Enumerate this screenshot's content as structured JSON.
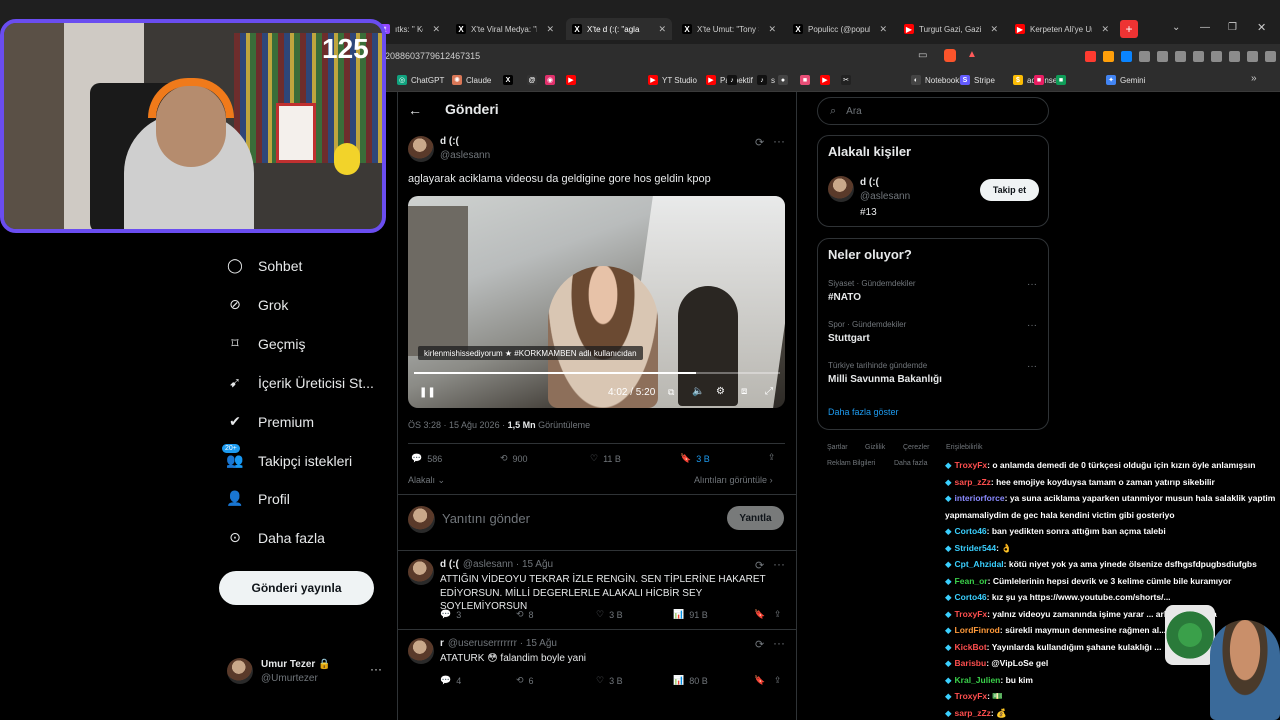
{
  "browser": {
    "tabs": [
      {
        "label": "ıtks: \" Konsol O",
        "icon": "twitch-icon",
        "color": "#9146ff"
      },
      {
        "label": "X'te Viral Medya: \"Big",
        "icon": "x-icon",
        "color": "#000000"
      },
      {
        "label": "X'te d (:(: \"agla",
        "icon": "x-icon",
        "color": "#000000",
        "active": true
      },
      {
        "label": "X'te Umut: \"Tony Stan",
        "icon": "x-icon",
        "color": "#000000"
      },
      {
        "label": "Populicc (@populicc)",
        "icon": "x-icon",
        "color": "#000000"
      },
      {
        "label": "Turgut Gazi, Gazi alp",
        "icon": "youtube-icon",
        "color": "#ff0000"
      },
      {
        "label": "Kerpeten Ali'ye Unutu",
        "icon": "youtube-icon",
        "color": "#ff0000"
      }
    ],
    "url": "2088603779612467315",
    "bookmarks": [
      {
        "label": "ChatGPT",
        "icon": "chatgpt-icon",
        "color": "#10a37f"
      },
      {
        "label": "Claude",
        "icon": "claude-icon",
        "color": "#d97757"
      },
      {
        "label": "",
        "icon": "x-icon",
        "color": "#000000"
      },
      {
        "label": "",
        "icon": "threads-icon",
        "color": "#333333"
      },
      {
        "label": "",
        "icon": "instagram-icon",
        "color": "#e1306c"
      },
      {
        "label": "",
        "icon": "youtube-icon",
        "color": "#ff0000"
      },
      {
        "label": "YT Studio",
        "icon": "youtube-studio-icon",
        "color": "#ff0000"
      },
      {
        "label": "Paspektif",
        "icon": "youtube-icon",
        "color": "#ff0000"
      },
      {
        "label": "",
        "icon": "tiktok-icon",
        "color": "#111111"
      },
      {
        "label": "s",
        "icon": "tiktok-icon",
        "color": "#111111"
      },
      {
        "label": "",
        "icon": "circle-icon",
        "color": "#444444"
      },
      {
        "label": "",
        "icon": "app-icon",
        "color": "#e94e77"
      },
      {
        "label": "",
        "icon": "youtube-icon",
        "color": "#ff0000"
      },
      {
        "label": "",
        "icon": "capcut-icon",
        "color": "#222222"
      },
      {
        "label": "NotebookLM",
        "icon": "notebooklm-icon",
        "color": "#444444"
      },
      {
        "label": "Stripe",
        "icon": "stripe-icon",
        "color": "#635bff"
      },
      {
        "label": "adsense",
        "icon": "adsense-icon",
        "color": "#fbbc04"
      },
      {
        "label": "",
        "icon": "app-icon",
        "color": "#e91e63"
      },
      {
        "label": "",
        "icon": "app-icon",
        "color": "#0f9d58"
      },
      {
        "label": "Gemini",
        "icon": "gemini-icon",
        "color": "#4285f4"
      }
    ]
  },
  "stream": {
    "counter": "125"
  },
  "sidebar": {
    "items": [
      {
        "label": "Sohbet",
        "icon": "chat-icon"
      },
      {
        "label": "Grok",
        "icon": "grok-icon"
      },
      {
        "label": "Geçmiş",
        "icon": "bookmark-icon"
      },
      {
        "label": "İçerik Üreticisi St...",
        "icon": "rocket-icon"
      },
      {
        "label": "Premium",
        "icon": "premium-icon"
      },
      {
        "label": "Takipçi istekleri",
        "icon": "followers-icon",
        "badge": "20+"
      },
      {
        "label": "Profil",
        "icon": "profile-icon"
      },
      {
        "label": "Daha fazla",
        "icon": "more-circle-icon"
      }
    ],
    "post_button": "Gönderi yayınla",
    "account": {
      "name": "Umur Tezer",
      "handle": "@Umurtezer"
    }
  },
  "main": {
    "header_title": "Gönderi",
    "post": {
      "author": "d (:(",
      "handle": "@aslesann",
      "text": "aglayarak aciklama videosu da geldigine gore hos geldin kpop",
      "video": {
        "caption": "kirlenmishissediyorum ★ #KORKMAMBEN adlı kullanıcıdan",
        "time": "4:02 / 5:20",
        "progress": 0.77
      },
      "meta_time": "ÖS 3:28 · 15 Ağu 2026 · ",
      "views": "1,5 Mn",
      "views_label": " Görüntüleme",
      "stats": {
        "replies": "586",
        "reposts": "900",
        "likes": "11 B",
        "bookmarks": "3 B"
      },
      "relevance": "Alakalı",
      "quotes_link": "Alıntıları görüntüle"
    },
    "reply_placeholder": "Yanıtını gönder",
    "reply_button": "Yanıtla",
    "replies": [
      {
        "author": "d (:(",
        "handle": "@aslesann · 15 Ağu",
        "text": "ATTIĞIN VİDEOYU TEKRAR İZLE RENGİN. SEN TİPLERİNE HAKARET EDİYORSUN. MİLLİ DEGERLERLE ALAKALI HİCBİR SEY SOYLEMİYORSUN",
        "stats": {
          "replies": "3",
          "reposts": "8",
          "likes": "3 B",
          "views": "91 B"
        }
      },
      {
        "author": "r",
        "handle": "@useruserrrrrrr · 15 Ağu",
        "text": "ATATURK 😳 falandim boyle yani",
        "stats": {
          "replies": "4",
          "reposts": "6",
          "likes": "3 B",
          "views": "80 B"
        }
      }
    ]
  },
  "right": {
    "search_placeholder": "Ara",
    "relevant_title": "Alakalı kişiler",
    "relevant_person": {
      "name": "d (:(",
      "handle": "@aslesann",
      "bio": "#13",
      "follow": "Takip et"
    },
    "trends_title": "Neler oluyor?",
    "trends": [
      {
        "category": "Siyaset · Gündemdekiler",
        "name": "#NATO"
      },
      {
        "category": "Spor · Gündemdekiler",
        "name": "Stuttgart"
      },
      {
        "category": "Türkiye tarihinde gündemde",
        "name": "Milli Savunma Bakanlığı"
      }
    ],
    "show_more": "Daha fazla göster",
    "footer": [
      "Şartlar",
      "Gizlilik",
      "Çerezler",
      "Erişilebilirlik",
      "Reklam Bilgileri",
      "Daha fazla"
    ]
  },
  "chat": {
    "messages": [
      {
        "user": "TroxyFx",
        "color": "#ff4f4f",
        "text": ": o anlamda demedi de 0 türkçesi olduğu için kızın öyle anlamışsın"
      },
      {
        "user": "sarp_zZz",
        "color": "#ff4f4f",
        "text": ": hee emojiye koyduysa tamam o zaman yatırıp sikebilir"
      },
      {
        "user": "interiorforce",
        "color": "#8a8aff",
        "text": ": ya suna aciklama yaparken utanmiyor musun hala salaklik yaptim"
      },
      {
        "user": "",
        "color": "#ffffff",
        "text": "yapmamaliydim de gec hala kendini victim gibi gosteriyo"
      },
      {
        "user": "Corto46",
        "color": "#3ad0ff",
        "text": ": ban yedikten sonra attığım ban açma talebi"
      },
      {
        "user": "Strider544",
        "color": "#3ad0ff",
        "text": ": 👌"
      },
      {
        "user": "Cpt_Ahzidal",
        "color": "#3ad0ff",
        "text": ": kötü niyet yok ya ama yinede ölsenize dsfhgsfdpugbsdiufgbs"
      },
      {
        "user": "Fean_or",
        "color": "#3ad04a",
        "text": ": Cümlelerinin hepsi devrik ve 3 kelime cümle bile kuramıyor"
      },
      {
        "user": "Corto46",
        "color": "#3ad0ff",
        "text": ": kız şu ya https://www.youtube.com/shorts/..."
      },
      {
        "user": "TroxyFx",
        "color": "#ff4f4f",
        "text": ": yalnız videoyu zamanında işime yarar ... arkadaşın çaka"
      },
      {
        "user": "LordFinrod",
        "color": "#ff9a3a",
        "text": ": sürekli maymun denmesine rağmen al..."
      },
      {
        "user": "KickBot",
        "color": "#ff4f4f",
        "text": ": Yayınlarda kullandığım şahane kulaklığı ..."
      },
      {
        "user": "Barisbu",
        "color": "#ff4f4f",
        "text": ": @VipLoSe gel"
      },
      {
        "user": "Kral_Julien",
        "color": "#3ad04a",
        "text": ": bu kim"
      },
      {
        "user": "TroxyFx",
        "color": "#ff4f4f",
        "text": ": 💵"
      },
      {
        "user": "sarp_zZz",
        "color": "#ff4f4f",
        "text": ": 💰"
      }
    ]
  }
}
